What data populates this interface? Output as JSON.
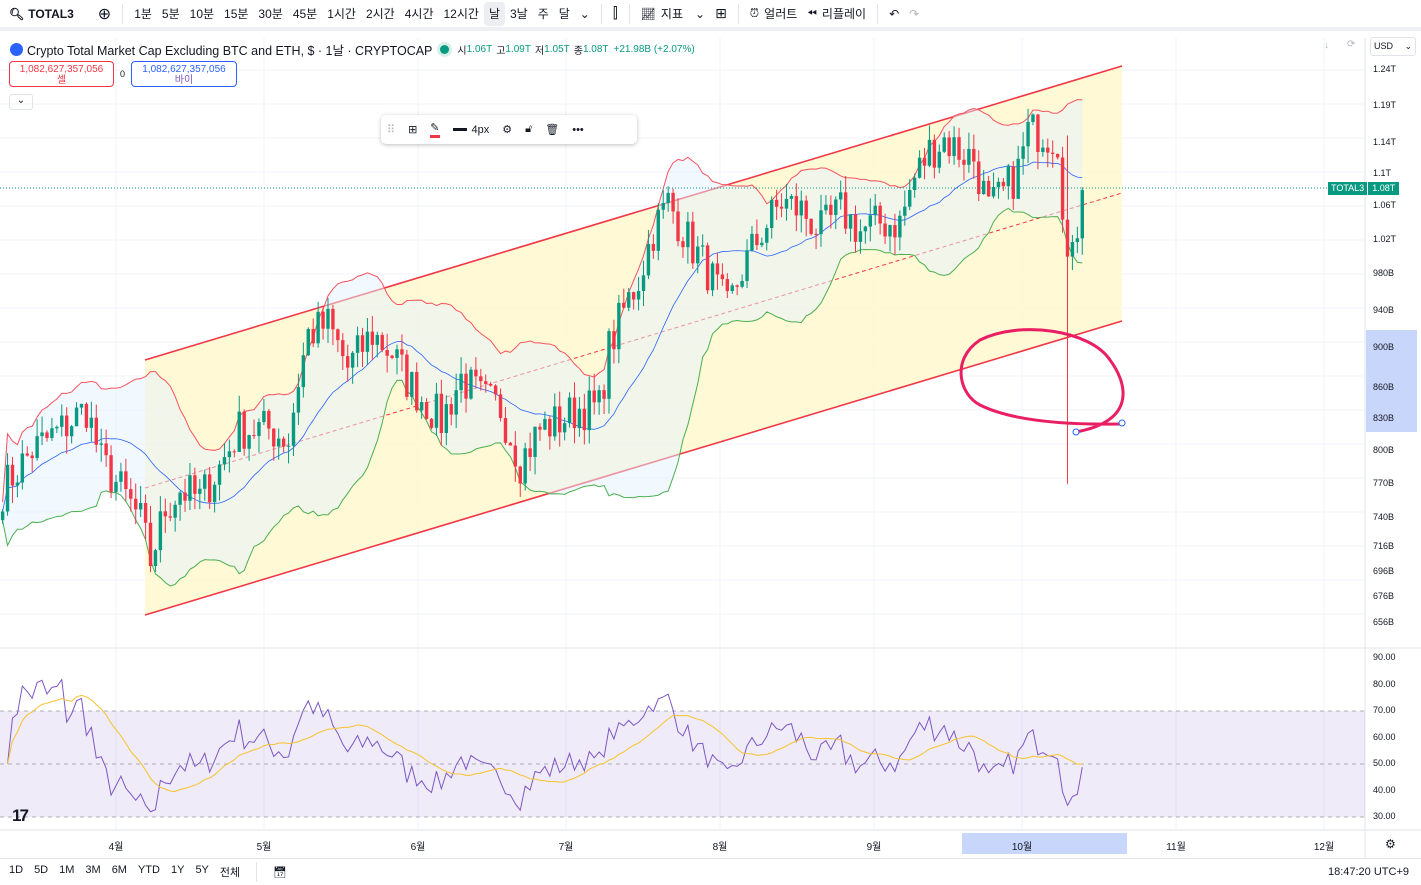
{
  "toolbar": {
    "symbol": "TOTAL3",
    "intervals": [
      "1분",
      "5분",
      "10분",
      "15분",
      "30분",
      "45분",
      "1시간",
      "2시간",
      "4시간",
      "12시간",
      "날",
      "3날",
      "주",
      "달"
    ],
    "selected_interval": "날",
    "indicators": "지표",
    "alert": "얼러트",
    "replay": "리플레이"
  },
  "legend": {
    "title": "Crypto Total Market Cap Excluding BTC and ETH, $ · 1날 · CRYPTOCAP",
    "o_label": "시",
    "o": "1.06T",
    "h_label": "고",
    "h": "1.09T",
    "l_label": "저",
    "l": "1.05T",
    "c_label": "종",
    "c": "1.08T",
    "change": "+21.98B (+2.07%)"
  },
  "sell": {
    "price": "1,082,627,357,056",
    "label": "셀"
  },
  "spread": "0",
  "buy": {
    "price": "1,082,627,357,056",
    "label": "바이"
  },
  "currency": "USD",
  "price_axis": [
    "1.24T",
    "1.19T",
    "1.14T",
    "1.1T",
    "1.06T",
    "1.02T",
    "980B",
    "940B",
    "900B",
    "860B",
    "830B",
    "800B",
    "770B",
    "740B",
    "716B",
    "696B",
    "676B",
    "656B"
  ],
  "last_price": {
    "symbol": "TOTAL3",
    "value": "1.08T"
  },
  "rsi_axis": [
    "90.00",
    "80.00",
    "70.00",
    "60.00",
    "50.00",
    "40.00",
    "30.00"
  ],
  "drawing_toolbar": {
    "width_label": "4px"
  },
  "time_axis": [
    "4월",
    "5월",
    "6월",
    "7월",
    "8월",
    "9월",
    "10월",
    "11월",
    "12월"
  ],
  "ranges": [
    "1D",
    "5D",
    "1M",
    "3M",
    "6M",
    "YTD",
    "1Y",
    "5Y",
    "전체"
  ],
  "clock": "18:47:20 UTC+9",
  "colors": {
    "up": "#089981",
    "down": "#f23645",
    "channel": "#f23645",
    "rsi": "#7e57c2"
  },
  "chart_data": {
    "type": "candlestick",
    "x_unit": "days from Apr 1",
    "y_unit": "B USD",
    "scale": "log",
    "points": [
      [
        -23,
        765
      ],
      [
        -17,
        800
      ],
      [
        -11,
        820
      ],
      [
        -6,
        840
      ],
      [
        -3,
        790
      ],
      [
        1,
        765
      ],
      [
        5,
        738
      ],
      [
        7,
        705
      ],
      [
        10,
        748
      ],
      [
        13,
        765
      ],
      [
        17,
        757
      ],
      [
        21,
        785
      ],
      [
        25,
        820
      ],
      [
        31,
        820
      ],
      [
        35,
        810
      ],
      [
        37,
        868
      ],
      [
        39,
        915
      ],
      [
        43,
        925
      ],
      [
        47,
        880
      ],
      [
        52,
        915
      ],
      [
        56,
        895
      ],
      [
        59,
        868
      ],
      [
        62,
        850
      ],
      [
        66,
        828
      ],
      [
        70,
        870
      ],
      [
        74,
        850
      ],
      [
        78,
        840
      ],
      [
        82,
        790
      ],
      [
        86,
        820
      ],
      [
        90,
        828
      ],
      [
        94,
        840
      ],
      [
        98,
        840
      ],
      [
        100,
        900
      ],
      [
        103,
        940
      ],
      [
        106,
        975
      ],
      [
        109,
        1030
      ],
      [
        112,
        1065
      ],
      [
        116,
        1020
      ],
      [
        120,
        985
      ],
      [
        124,
        940
      ],
      [
        127,
        985
      ],
      [
        131,
        1030
      ],
      [
        135,
        1065
      ],
      [
        139,
        1055
      ],
      [
        143,
        1030
      ],
      [
        147,
        1055
      ],
      [
        151,
        1030
      ],
      [
        155,
        1040
      ],
      [
        159,
        1040
      ],
      [
        162,
        1095
      ],
      [
        165,
        1130
      ],
      [
        168,
        1145
      ],
      [
        171,
        1130
      ],
      [
        174,
        1120
      ],
      [
        177,
        1055
      ],
      [
        180,
        1075
      ],
      [
        183,
        1105
      ],
      [
        185,
        1155
      ],
      [
        188,
        1155
      ],
      [
        191,
        1145
      ],
      [
        193,
        995
      ],
      [
        194,
        995
      ],
      [
        196,
        1080
      ]
    ]
  }
}
